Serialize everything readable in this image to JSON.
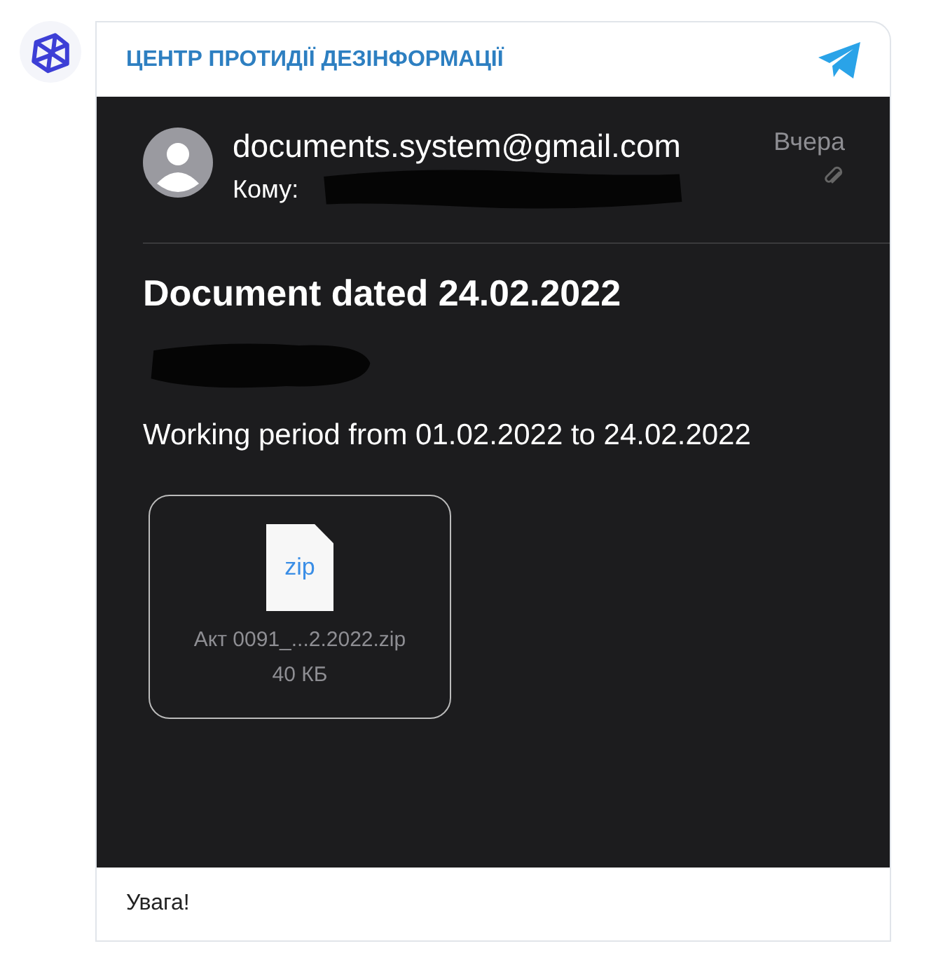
{
  "post": {
    "channel": "ЦЕНТР ПРОТИДІЇ ДЕЗІНФОРМАЦІЇ",
    "email": {
      "sender": "documents.system@gmail.com",
      "to_label": "Кому:",
      "date": "Вчера",
      "subject": "Document dated 24.02.2022",
      "body": "Working period from 01.02.2022 to 24.02.2022",
      "attachment": {
        "icon_label": "zip",
        "name": "Акт 0091_...2.2022.zip",
        "size": "40 КБ"
      }
    },
    "text": "Увага!"
  }
}
